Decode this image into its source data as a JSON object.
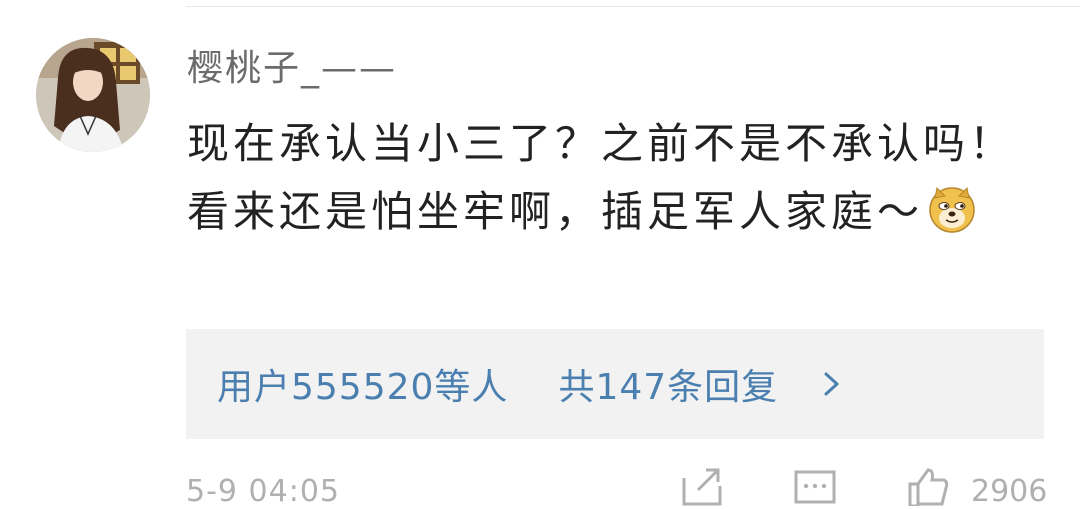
{
  "comment": {
    "username": "樱桃子_——",
    "text": "现在承认当小三了？之前不是不承认吗！看来还是怕坐牢啊，插足军人家庭～",
    "emoji_icon": "doge-emoji-icon"
  },
  "replies": {
    "users_text": "用户555520等人",
    "count_text": "共147条回复"
  },
  "footer": {
    "time": "5-9 04:05",
    "like_count": "2906"
  },
  "colors": {
    "link": "#4a7fb0",
    "muted": "#b0b0b0",
    "reply_bg": "#f2f2f2"
  }
}
